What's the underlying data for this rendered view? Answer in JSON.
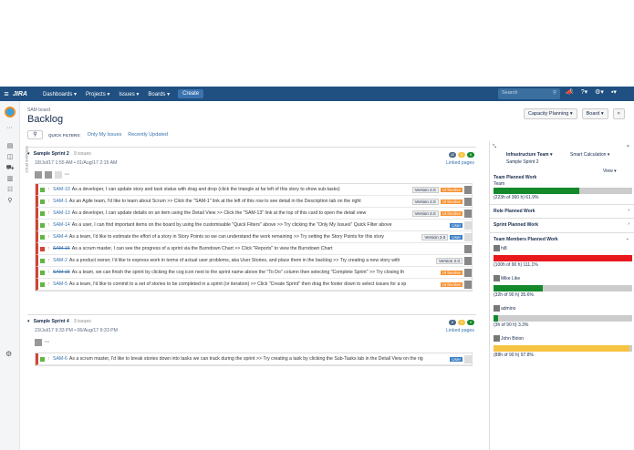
{
  "nav": {
    "menus": [
      "Dashboards ▾",
      "Projects ▾",
      "Issues ▾",
      "Boards ▾"
    ],
    "create": "Create",
    "search_placeholder": "Search",
    "logo": "JIRA"
  },
  "header": {
    "board": "SAM board",
    "title": "Backlog"
  },
  "quick_filters": {
    "label": "QUICK FILTERS:",
    "items": [
      "Only My Issues",
      "Recently Updated"
    ]
  },
  "top_buttons": {
    "capacity": "Capacity Planning ▾",
    "board": "Board ▾",
    "close": "×"
  },
  "vertical_labels": {
    "versions": "VERSIONS",
    "epics": "EPICS"
  },
  "sprint2": {
    "name": "Sample Sprint 2",
    "count": "9 issues",
    "dates": "18/Jul/17 1:55 AM • 01/Aug/17 2:15 AM",
    "linked": "Linked pages",
    "badges": [
      "42",
      "4",
      "6"
    ],
    "issues": [
      {
        "key": "SAM-10",
        "summary": "As a developer, I can update story and task status with drag and drop (click the triangle at far left of this story to show sub-tasks)",
        "version": "Version 2.0",
        "epic": "UI fevolve",
        "type": "story"
      },
      {
        "key": "SAM-1",
        "summary": "As an Agile team, I'd like to learn about Scrum >> Click the \"SAM-1\" link at the left of this row to see detail in the Description tab on the right",
        "version": "Version 2.0",
        "epic": "UI fevolve",
        "type": "story"
      },
      {
        "key": "SAM-13",
        "summary": "As a developer, I can update details on an item using the Detail View >> Click the \"SAM-13\" link at the top of this card to open the detail view",
        "version": "Version 2.0",
        "epic": "UI fevolve",
        "type": "story"
      },
      {
        "key": "SAM-14",
        "summary": "As a user, I can find important items on the board by using the customisable \"Quick Filters\" above >> Try clicking the \"Only My Issues\" Quick Filter above",
        "label": "User",
        "type": "story"
      },
      {
        "key": "SAM-4",
        "summary": "As a team, I'd like to estimate the effort of a story in Story Points so we can understand the work remaining >> Try setting the Story Points for this story",
        "version": "Version 3.0",
        "label": "User",
        "type": "story"
      },
      {
        "key": "SAM-16",
        "summary": "As a scrum master, I can see the progress of a sprint via the Burndown Chart >> Click \"Reports\" to view the Burndown Chart",
        "type": "bug",
        "done": true
      },
      {
        "key": "SAM-2",
        "summary": "As a product owner, I'd like to express work in terms of actual user problems, aka User Stories, and place them in the backlog >> Try creating a new story with",
        "version": "Version 2.0",
        "type": "story"
      },
      {
        "key": "SAM-15",
        "summary": "As a team, we can finish the sprint by clicking the cog icon next to the sprint name above the \"To Do\" column then selecting \"Complete Sprint\" >> Try closing th",
        "epic": "UI fevolve",
        "type": "story",
        "done": true
      },
      {
        "key": "SAM-5",
        "summary": "As a team, I'd like to commit to a set of stories to be completed in a sprint (or iteration) >> Click \"Create Sprint\" then drag the footer down to select issues for a sp",
        "epic": "UI fevolve",
        "type": "story"
      }
    ]
  },
  "sprint4": {
    "name": "Sample Sprint 4",
    "count": "3 issues",
    "dates": "23/Jul/17 9:33 PM • 06/Aug/17 9:33 PM",
    "linked": "Linked pages",
    "badges": [
      "6",
      "0",
      "0"
    ],
    "issues": [
      {
        "key": "SAM-6",
        "summary": "As a scrum master, I'd like to break stories down into tasks we can track during the sprint >> Try creating a task by clicking the Sub-Tasks tab in the Detail View on the rig",
        "label": "User",
        "type": "story"
      }
    ]
  },
  "right_panel": {
    "team": "Infrastructure Team ▾",
    "calc": "Smart Calculation ▾",
    "sprint": "Sample Sprint 2",
    "view": "View ▾",
    "team_planned": {
      "title": "Team Planned Work",
      "sub": "Team",
      "text": "(223h of 360 h) 61.9%",
      "pct": 61.9
    },
    "role_planned": "Role Planned Work",
    "sprint_planned": "Sprint Planned Work",
    "members_title": "Team Members Planned Work",
    "members": [
      {
        "name": "hi8",
        "text": "(100h of 90 h) 111.1%",
        "pct": 100,
        "color": "#e8191c"
      },
      {
        "name": "Mike Like",
        "text": "(32h of 90 h) 35.6%",
        "pct": 35.6,
        "color": "#14892c"
      },
      {
        "name": "admino",
        "text": "(3h of 90 h) 3.3%",
        "pct": 3.3,
        "color": "#14892c"
      },
      {
        "name": "John Birion",
        "text": "(88h of 90 h) 97.8%",
        "pct": 97.8,
        "color": "#f6c342"
      }
    ]
  }
}
